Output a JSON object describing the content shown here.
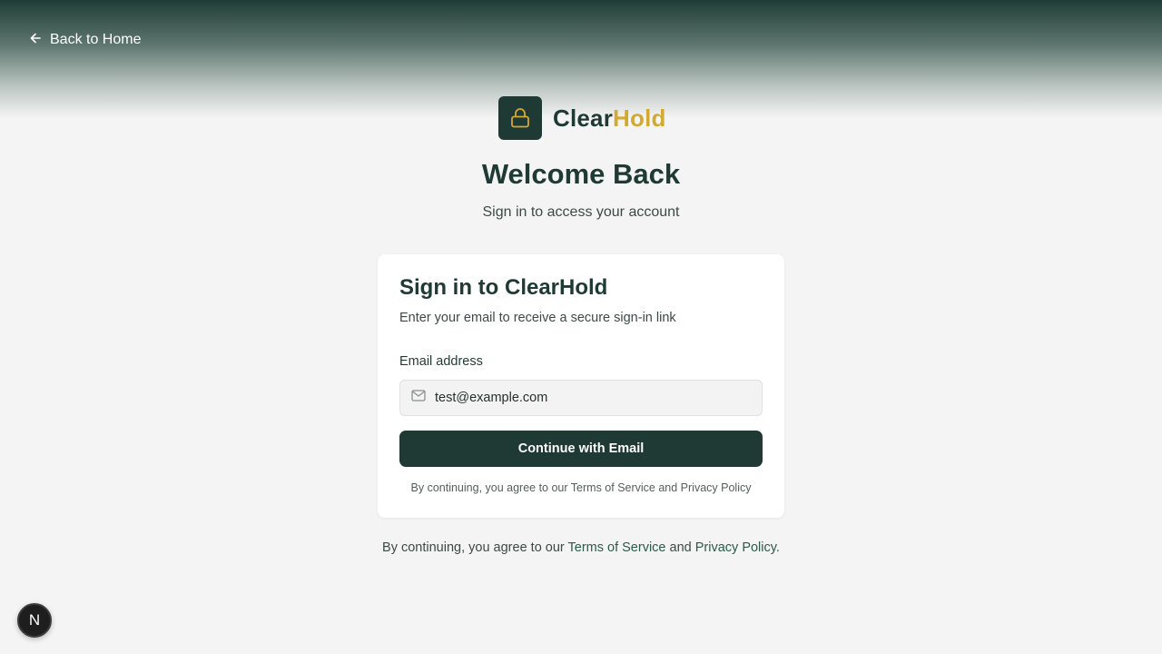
{
  "header": {
    "back_label": "Back to Home",
    "back_icon": "arrow-left-icon"
  },
  "brand": {
    "logo_icon": "lock-icon",
    "name_part1": "Clear",
    "name_part2": "Hold",
    "color_primary": "#1f3a34",
    "color_accent": "#d2a933"
  },
  "hero": {
    "title": "Welcome Back",
    "subtitle": "Sign in to access your account"
  },
  "signin_card": {
    "title": "Sign in to ClearHold",
    "description": "Enter your email to receive a secure sign-in link",
    "email_label": "Email address",
    "email_icon": "mail-icon",
    "email_value": "test@example.com",
    "submit_label": "Continue with Email",
    "terms_text": "By continuing, you agree to our Terms of Service and Privacy Policy"
  },
  "footer": {
    "prefix": "By continuing, you agree to our ",
    "terms_link": "Terms of Service",
    "and": " and ",
    "privacy_link": "Privacy Policy",
    "suffix": "."
  },
  "dev_badge": {
    "label": "N"
  }
}
